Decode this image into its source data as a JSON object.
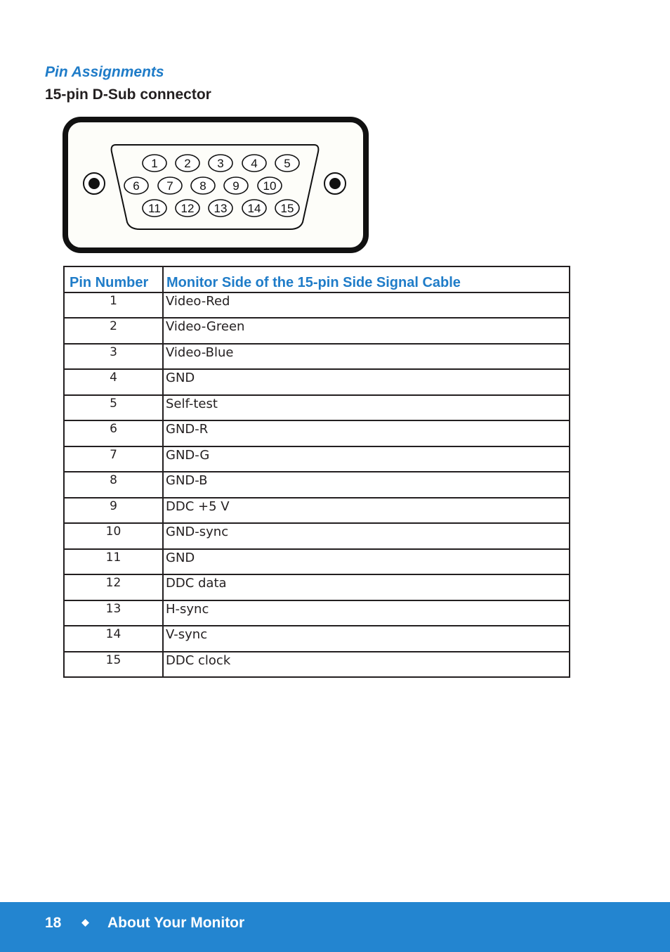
{
  "header": {
    "section_title": "Pin Assignments",
    "subtitle": "15-pin D-Sub connector"
  },
  "connector_diagram": {
    "pin_labels": [
      "1",
      "2",
      "3",
      "4",
      "5",
      "6",
      "7",
      "8",
      "9",
      "10",
      "11",
      "12",
      "13",
      "14",
      "15"
    ]
  },
  "pin_table": {
    "columns": [
      "Pin Number",
      "Monitor Side of the 15-pin Side Signal Cable"
    ],
    "rows": [
      {
        "pin": "1",
        "signal": "Video-Red"
      },
      {
        "pin": "2",
        "signal": "Video-Green"
      },
      {
        "pin": "3",
        "signal": "Video-Blue"
      },
      {
        "pin": "4",
        "signal": "GND"
      },
      {
        "pin": "5",
        "signal": "Self-test"
      },
      {
        "pin": "6",
        "signal": "GND-R"
      },
      {
        "pin": "7",
        "signal": "GND-G"
      },
      {
        "pin": "8",
        "signal": "GND-B"
      },
      {
        "pin": "9",
        "signal": "DDC +5 V"
      },
      {
        "pin": "10",
        "signal": "GND-sync"
      },
      {
        "pin": "11",
        "signal": "GND"
      },
      {
        "pin": "12",
        "signal": "DDC data"
      },
      {
        "pin": "13",
        "signal": "H-sync"
      },
      {
        "pin": "14",
        "signal": "V-sync"
      },
      {
        "pin": "15",
        "signal": "DDC clock"
      }
    ]
  },
  "footer": {
    "page_number": "18",
    "separator_icon": "diamond-icon",
    "chapter_title": "About Your Monitor"
  },
  "colors": {
    "accent_blue": "#1f7cc8",
    "footer_blue": "#2385d0",
    "text": "#231f20"
  }
}
